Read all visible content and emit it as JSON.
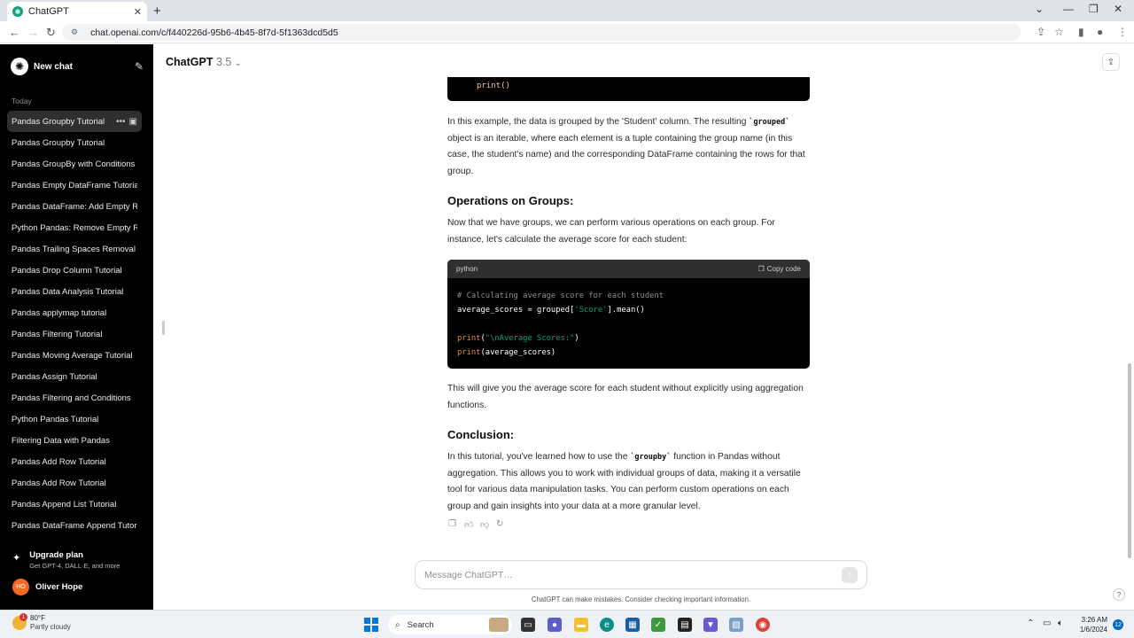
{
  "browser": {
    "tab_title": "ChatGPT",
    "url": "chat.openai.com/c/f440226d-95b6-4b45-8f7d-5f1363dcd5d5"
  },
  "sidebar": {
    "new_chat": "New chat",
    "section_today": "Today",
    "chats": [
      "Pandas Groupby Tutorial",
      "Pandas Groupby Tutorial",
      "Pandas GroupBy with Conditions",
      "Pandas Empty DataFrame Tutorial",
      "Pandas DataFrame: Add Empty R",
      "Python Pandas: Remove Empty R",
      "Pandas Trailing Spaces Removal",
      "Pandas Drop Column Tutorial",
      "Pandas Data Analysis Tutorial",
      "Pandas applymap tutorial",
      "Pandas Filtering Tutorial",
      "Pandas Moving Average Tutorial",
      "Pandas Assign Tutorial",
      "Pandas Filtering and Conditions",
      "Python Pandas Tutorial",
      "Filtering Data with Pandas",
      "Pandas Add Row Tutorial",
      "Pandas Add Row Tutorial",
      "Pandas Append List Tutorial",
      "Pandas DataFrame Append Tutor"
    ],
    "upgrade_title": "Upgrade plan",
    "upgrade_sub": "Get GPT-4, DALL·E, and more",
    "user_initials": "HO",
    "user_name": "Oliver Hope"
  },
  "header": {
    "model": "ChatGPT",
    "version": "3.5"
  },
  "content": {
    "top_code_line": "print()",
    "p1_a": "In this example, the data is grouped by the 'Student' column. The resulting ",
    "p1_code": "`grouped`",
    "p1_b": " object is an iterable, where each element is a tuple containing the group name (in this case, the student's name) and the corresponding DataFrame containing the rows for that group.",
    "h_operations": "Operations on Groups:",
    "p2": "Now that we have groups, we can perform various operations on each group. For instance, let's calculate the average score for each student:",
    "code_lang": "python",
    "copy_label": "Copy code",
    "code_comment": "# Calculating average score for each student",
    "code_l2_a": "average_scores = grouped[",
    "code_l2_str": "'Score'",
    "code_l2_b": "].mean()",
    "code_l4_fn": "print",
    "code_l4_paren": "(",
    "code_l4_str": "\"\\nAverage Scores:\"",
    "code_l4_end": ")",
    "code_l5_fn": "print",
    "code_l5_rest": "(average_scores)",
    "p3": "This will give you the average score for each student without explicitly using aggregation functions.",
    "h_conclusion": "Conclusion:",
    "p4_a": "In this tutorial, you've learned how to use the ",
    "p4_code": "`groupby`",
    "p4_b": " function in Pandas without aggregation. This allows you to work with individual groups of data, making it a versatile tool for various data manipulation tasks. You can perform custom operations on each group and gain insights into your data at a more granular level."
  },
  "input": {
    "placeholder": "Message ChatGPT…",
    "disclaimer": "ChatGPT can make mistakes. Consider checking important information."
  },
  "taskbar": {
    "temp": "80°F",
    "condition": "Partly cloudy",
    "weather_badge": "1",
    "search_label": "Search",
    "time": "3:26 AM",
    "date": "1/6/2024",
    "notifications": "12"
  },
  "colors": {
    "sidebar_bg": "#000000",
    "accent": "#10a37f",
    "avatar": "#f46a25",
    "code_string": "#00a67d",
    "code_fn": "#e9950c"
  }
}
